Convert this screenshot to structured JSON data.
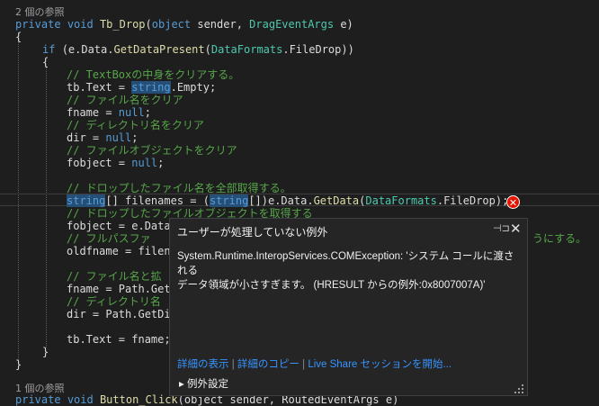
{
  "editor": {
    "ref_count_top": "2 個の参照",
    "ref_count_bottom": "1 個の参照",
    "lines": {
      "sig_private": "private",
      "sig_void": "void",
      "sig_name": "Tb_Drop",
      "sig_object": "object",
      "sig_sender": "sender,",
      "sig_type": "DragEventArgs",
      "sig_e": "e)",
      "brace_open": "{",
      "if_kw": "if",
      "if_a": "(e.Data.",
      "if_fn": "GetDataPresent",
      "if_type": "DataFormats",
      "if_b": ".FileDrop))",
      "brace2_open": "{",
      "c1": "// TextBoxの中身をクリアする。",
      "l1_a": "tb.Text = ",
      "l1_kw": "string",
      "l1_b": ".Empty;",
      "c2": "// ファイル名をクリア",
      "l2_a": "fname = ",
      "l2_kw": "null",
      "c3": "// ディレクトリ名をクリア",
      "l3_a": "dir = ",
      "l3_kw": "null",
      "c4": "// ファイルオブジェクトをクリア",
      "l4_a": "fobject = ",
      "l4_kw": "null",
      "semi": ";",
      "c5": "// ドロップしたファイル名を全部取得する。",
      "l5_kw": "string",
      "l5_a": "[] filenames = (",
      "l5_kw2": "string",
      "l5_b": "[])e.Data.",
      "l5_fn": "GetData",
      "l5_c": "(",
      "l5_type": "DataFormats",
      "l5_d": ".FileDrop);",
      "c6": "// ドロップしたファイルオブジェクトを取得する",
      "l6_a": "fobject = e.Data",
      "c7": "// フルパスファ",
      "c7_tail": "うにする。",
      "l7_a": "oldfname = filen",
      "c8": "// ファイル名と拡",
      "l8_a": "fname = Path.Get",
      "c9": "// ディレクトリ名",
      "l9_a": "dir = Path.GetDi",
      "l10_a": "tb.Text = fname;",
      "brace2_close": "}",
      "brace_close": "}",
      "bottom_private": "private",
      "bottom_void": "void",
      "bottom_name": "Button_Click",
      "bottom_rest": "(object sender, RoutedEventArgs e)"
    },
    "error_icon": "error-icon"
  },
  "popup": {
    "title": "ユーザーが処理していない例外",
    "pin_glyph": "⊣⊐",
    "close_glyph": "✕",
    "message_line1": "System.Runtime.InteropServices.COMException: 'システム コールに渡される",
    "message_line2": "データ領域が小さすぎます。 (HRESULT からの例外:0x8007007A)'",
    "links": [
      "詳細の表示",
      "詳細のコピー",
      "Live Share セッションを開始..."
    ],
    "settings_label": "例外設定",
    "settings_glyph": "▸"
  }
}
